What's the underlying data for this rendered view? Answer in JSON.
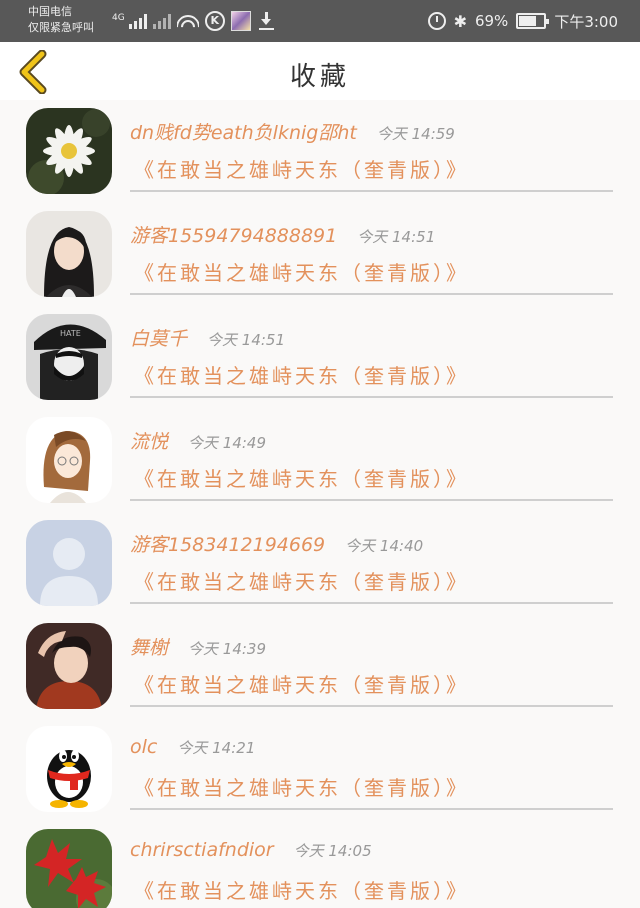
{
  "status_bar": {
    "carrier_line1": "中国电信",
    "carrier_line2": "仅限紧急呼叫",
    "network": "4G",
    "battery_percent": "69%",
    "battery_level": 0.69,
    "time": "下午3:00"
  },
  "header": {
    "title": "收藏"
  },
  "favorites": [
    {
      "name": "dn贱fd势eath负lknig邵ht",
      "time": "今天 14:59",
      "book": "《在敢当之雄峙天东（奎青版）》",
      "avatar": "flower"
    },
    {
      "name": "游客15594794888891",
      "time": "今天 14:51",
      "book": "《在敢当之雄峙天东（奎青版）》",
      "avatar": "girl"
    },
    {
      "name": "白莫千",
      "time": "今天 14:51",
      "book": "《在敢当之雄峙天东（奎青版）》",
      "avatar": "masked"
    },
    {
      "name": "流悦",
      "time": "今天 14:49",
      "book": "《在敢当之雄峙天东（奎青版）》",
      "avatar": "drawing"
    },
    {
      "name": "游客1583412194669",
      "time": "今天 14:40",
      "book": "《在敢当之雄峙天东（奎青版）》",
      "avatar": "default"
    },
    {
      "name": "舞榭",
      "time": "今天 14:39",
      "book": "《在敢当之雄峙天东（奎青版）》",
      "avatar": "man"
    },
    {
      "name": "olc",
      "time": "今天 14:21",
      "book": "《在敢当之雄峙天东（奎青版）》",
      "avatar": "qq"
    },
    {
      "name": "chrirsctiafndior",
      "time": "今天 14:05",
      "book": "《在敢当之雄峙天东（奎青版）》",
      "avatar": "maple"
    }
  ]
}
